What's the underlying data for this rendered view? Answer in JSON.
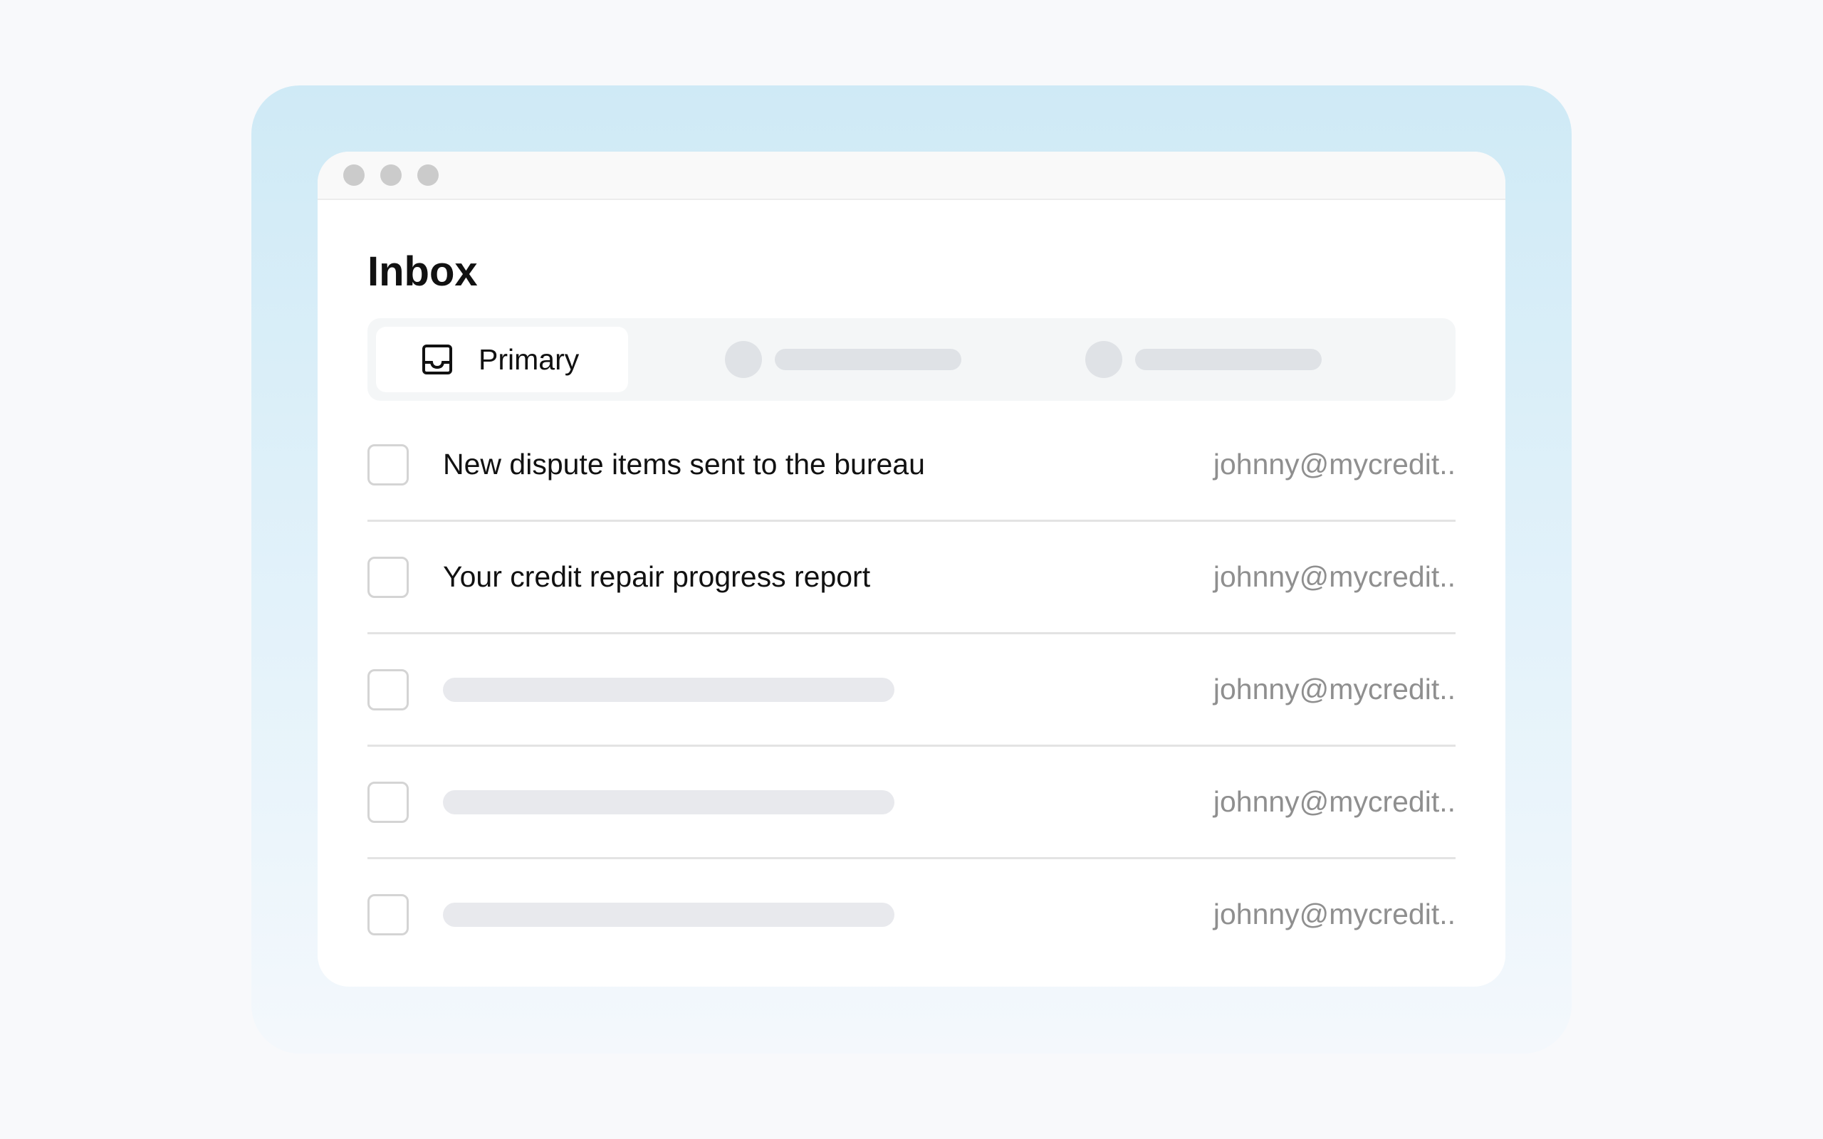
{
  "window": {
    "title": "Inbox"
  },
  "tabs": [
    {
      "label": "Primary",
      "icon": "inbox-tray-icon",
      "active": true
    }
  ],
  "emails": [
    {
      "subject": "New dispute items sent to the bureau",
      "sender": "johnny@mycredit.."
    },
    {
      "subject": "Your credit repair progress report",
      "sender": "johnny@mycredit.."
    },
    {
      "subject": "",
      "sender": "johnny@mycredit.."
    },
    {
      "subject": "",
      "sender": "johnny@mycredit.."
    },
    {
      "subject": "",
      "sender": "johnny@mycredit.."
    }
  ],
  "colors": {
    "background": "#f8f9fb",
    "backdrop_top": "#cfeaf6",
    "window": "#ffffff",
    "skeleton": "#dfe2e6",
    "sender_text": "#8f8f8f"
  }
}
